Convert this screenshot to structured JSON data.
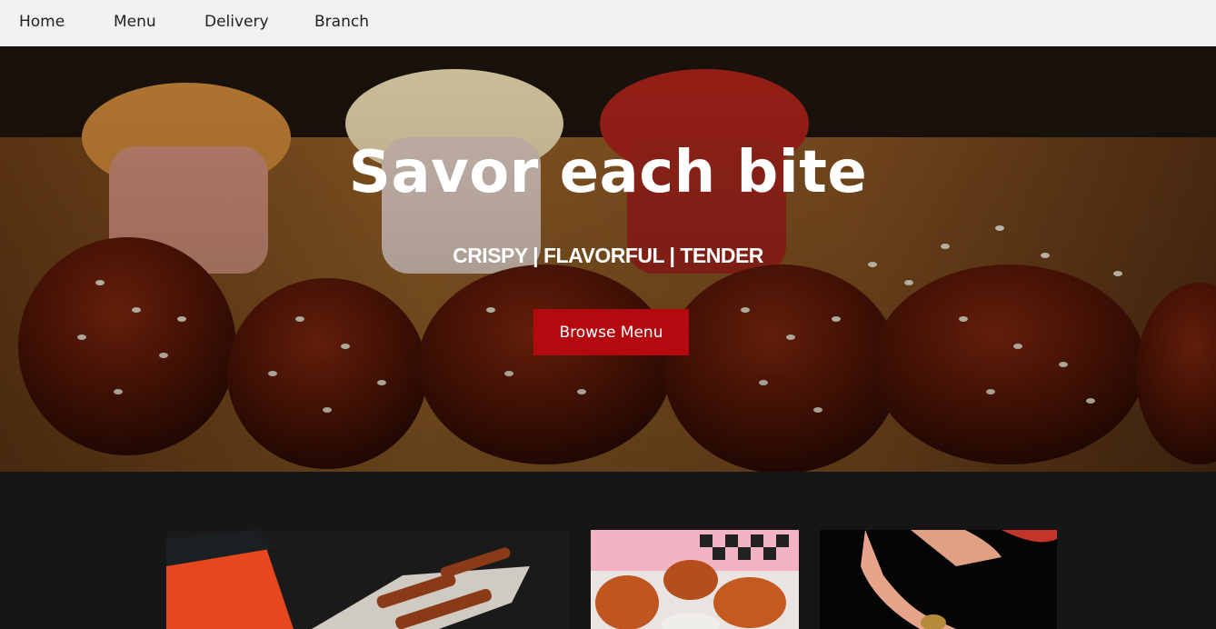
{
  "nav": {
    "home": "Home",
    "menu": "Menu",
    "delivery": "Delivery",
    "branch": "Branch"
  },
  "hero": {
    "title": "Savor each bite",
    "subtitle": "CRISPY | FLAVORFUL | TENDER",
    "button": "Browse Menu"
  },
  "colors": {
    "nav_bg": "#f1f1f1",
    "accent": "#b3090f",
    "page_bg": "#171617"
  }
}
